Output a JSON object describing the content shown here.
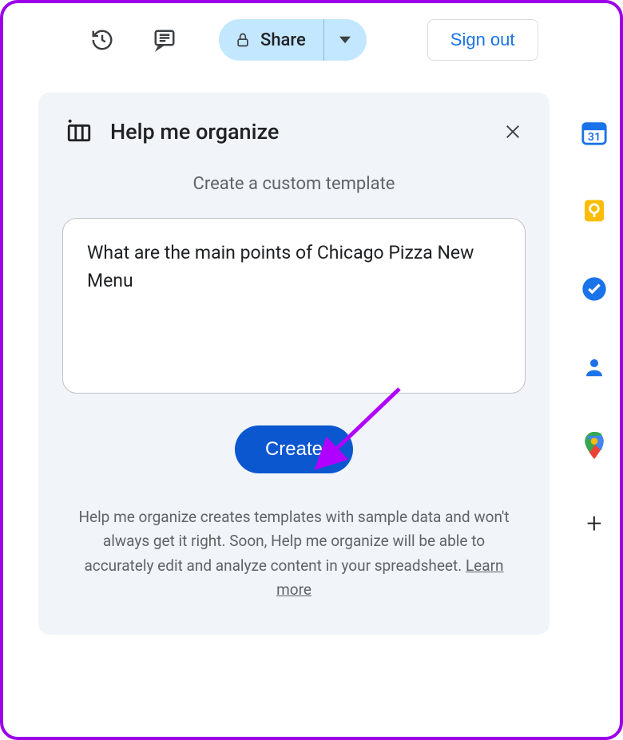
{
  "toolbar": {
    "share_label": "Share",
    "signout_label": "Sign out"
  },
  "panel": {
    "title": "Help me organize",
    "subtitle": "Create a custom template",
    "prompt_value": "What are the main points of Chicago Pizza New Menu",
    "create_label": "Create",
    "disclaimer_pre": "Help me organize creates templates with sample data and won't always get it right. Soon, Help me organize will be able to accurately edit and analyze content in your spreadsheet. ",
    "learn_more_label": "Learn more"
  },
  "siderail": {
    "calendar_day": "31"
  }
}
